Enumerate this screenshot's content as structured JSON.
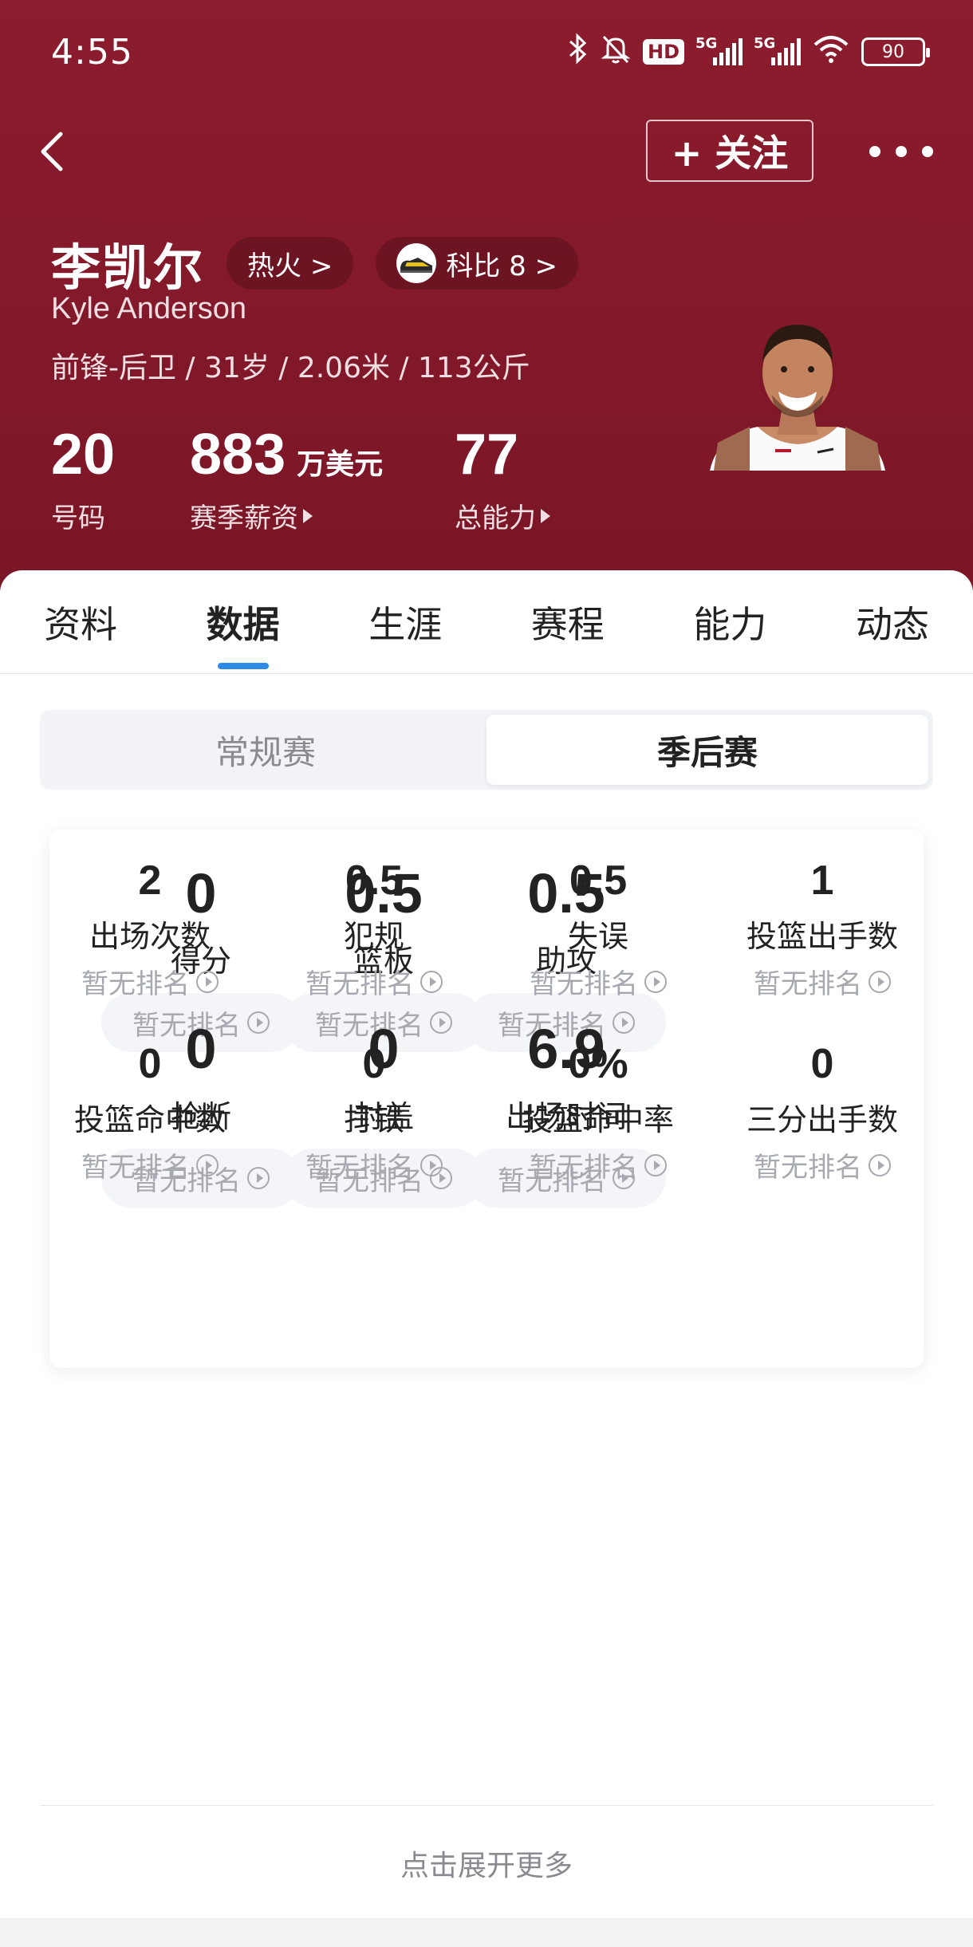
{
  "status": {
    "time": "4:55",
    "hd_label": "HD",
    "signal1": "5G",
    "signal2": "5G",
    "battery": "90"
  },
  "header": {
    "follow_label": "+ 关注",
    "name_cn": "李凯尔",
    "name_en": "Kyle Anderson",
    "team_pill": "热火 >",
    "compare_pill": "科比 8 >",
    "bio": "前锋-后卫 / 31岁 / 2.06米 / 113公斤",
    "number_value": "20",
    "number_label": "号码",
    "salary_value": "883",
    "salary_unit": "万美元",
    "salary_label": "赛季薪资",
    "rating_value": "77",
    "rating_label": "总能力"
  },
  "tabs": [
    "资料",
    "数据",
    "生涯",
    "赛程",
    "能力",
    "动态"
  ],
  "active_tab": "数据",
  "segments": {
    "regular": "常规赛",
    "playoffs": "季后赛",
    "active": "季后赛"
  },
  "main_stats": [
    {
      "value": "0",
      "label": "得分",
      "rank": "暂无排名"
    },
    {
      "value": "0.5",
      "label": "篮板",
      "rank": "暂无排名"
    },
    {
      "value": "0.5",
      "label": "助攻",
      "rank": "暂无排名"
    },
    {
      "value": "0",
      "label": "抢断",
      "rank": "暂无排名"
    },
    {
      "value": "0",
      "label": "封盖",
      "rank": "暂无排名"
    },
    {
      "value": "6.9",
      "label": "出场时间",
      "rank": "暂无排名"
    }
  ],
  "sub_stats": [
    {
      "value": "2",
      "label": "出场次数",
      "rank": "暂无排名"
    },
    {
      "value": "0.5",
      "label": "犯规",
      "rank": "暂无排名"
    },
    {
      "value": "0.5",
      "label": "失误",
      "rank": "暂无排名"
    },
    {
      "value": "1",
      "label": "投篮出手数",
      "rank": "暂无排名"
    },
    {
      "value": "0",
      "label": "投篮命中数",
      "rank": "暂无排名"
    },
    {
      "value": "0",
      "label": "打铁",
      "rank": "暂无排名"
    },
    {
      "value": "0%",
      "label": "投篮命中率",
      "rank": "暂无排名"
    },
    {
      "value": "0",
      "label": "三分出手数",
      "rank": "暂无排名"
    }
  ],
  "expand_label": "点击展开更多",
  "colors": {
    "header_bg": "#8c1c2e",
    "tab_indicator": "#2d8ae5",
    "rank_text": "#a7a9b0"
  }
}
